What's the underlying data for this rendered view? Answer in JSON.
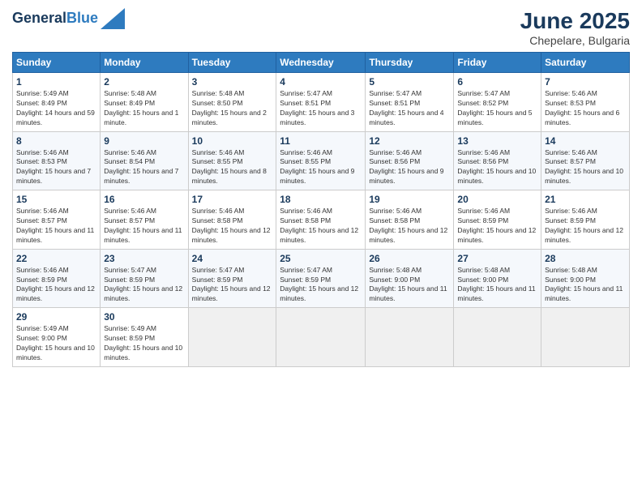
{
  "header": {
    "logo_line1": "General",
    "logo_line2": "Blue",
    "month": "June 2025",
    "location": "Chepelare, Bulgaria"
  },
  "days_of_week": [
    "Sunday",
    "Monday",
    "Tuesday",
    "Wednesday",
    "Thursday",
    "Friday",
    "Saturday"
  ],
  "weeks": [
    [
      {
        "num": "1",
        "sunrise": "Sunrise: 5:49 AM",
        "sunset": "Sunset: 8:49 PM",
        "daylight": "Daylight: 14 hours and 59 minutes."
      },
      {
        "num": "2",
        "sunrise": "Sunrise: 5:48 AM",
        "sunset": "Sunset: 8:49 PM",
        "daylight": "Daylight: 15 hours and 1 minute."
      },
      {
        "num": "3",
        "sunrise": "Sunrise: 5:48 AM",
        "sunset": "Sunset: 8:50 PM",
        "daylight": "Daylight: 15 hours and 2 minutes."
      },
      {
        "num": "4",
        "sunrise": "Sunrise: 5:47 AM",
        "sunset": "Sunset: 8:51 PM",
        "daylight": "Daylight: 15 hours and 3 minutes."
      },
      {
        "num": "5",
        "sunrise": "Sunrise: 5:47 AM",
        "sunset": "Sunset: 8:51 PM",
        "daylight": "Daylight: 15 hours and 4 minutes."
      },
      {
        "num": "6",
        "sunrise": "Sunrise: 5:47 AM",
        "sunset": "Sunset: 8:52 PM",
        "daylight": "Daylight: 15 hours and 5 minutes."
      },
      {
        "num": "7",
        "sunrise": "Sunrise: 5:46 AM",
        "sunset": "Sunset: 8:53 PM",
        "daylight": "Daylight: 15 hours and 6 minutes."
      }
    ],
    [
      {
        "num": "8",
        "sunrise": "Sunrise: 5:46 AM",
        "sunset": "Sunset: 8:53 PM",
        "daylight": "Daylight: 15 hours and 7 minutes."
      },
      {
        "num": "9",
        "sunrise": "Sunrise: 5:46 AM",
        "sunset": "Sunset: 8:54 PM",
        "daylight": "Daylight: 15 hours and 7 minutes."
      },
      {
        "num": "10",
        "sunrise": "Sunrise: 5:46 AM",
        "sunset": "Sunset: 8:55 PM",
        "daylight": "Daylight: 15 hours and 8 minutes."
      },
      {
        "num": "11",
        "sunrise": "Sunrise: 5:46 AM",
        "sunset": "Sunset: 8:55 PM",
        "daylight": "Daylight: 15 hours and 9 minutes."
      },
      {
        "num": "12",
        "sunrise": "Sunrise: 5:46 AM",
        "sunset": "Sunset: 8:56 PM",
        "daylight": "Daylight: 15 hours and 9 minutes."
      },
      {
        "num": "13",
        "sunrise": "Sunrise: 5:46 AM",
        "sunset": "Sunset: 8:56 PM",
        "daylight": "Daylight: 15 hours and 10 minutes."
      },
      {
        "num": "14",
        "sunrise": "Sunrise: 5:46 AM",
        "sunset": "Sunset: 8:57 PM",
        "daylight": "Daylight: 15 hours and 10 minutes."
      }
    ],
    [
      {
        "num": "15",
        "sunrise": "Sunrise: 5:46 AM",
        "sunset": "Sunset: 8:57 PM",
        "daylight": "Daylight: 15 hours and 11 minutes."
      },
      {
        "num": "16",
        "sunrise": "Sunrise: 5:46 AM",
        "sunset": "Sunset: 8:57 PM",
        "daylight": "Daylight: 15 hours and 11 minutes."
      },
      {
        "num": "17",
        "sunrise": "Sunrise: 5:46 AM",
        "sunset": "Sunset: 8:58 PM",
        "daylight": "Daylight: 15 hours and 12 minutes."
      },
      {
        "num": "18",
        "sunrise": "Sunrise: 5:46 AM",
        "sunset": "Sunset: 8:58 PM",
        "daylight": "Daylight: 15 hours and 12 minutes."
      },
      {
        "num": "19",
        "sunrise": "Sunrise: 5:46 AM",
        "sunset": "Sunset: 8:58 PM",
        "daylight": "Daylight: 15 hours and 12 minutes."
      },
      {
        "num": "20",
        "sunrise": "Sunrise: 5:46 AM",
        "sunset": "Sunset: 8:59 PM",
        "daylight": "Daylight: 15 hours and 12 minutes."
      },
      {
        "num": "21",
        "sunrise": "Sunrise: 5:46 AM",
        "sunset": "Sunset: 8:59 PM",
        "daylight": "Daylight: 15 hours and 12 minutes."
      }
    ],
    [
      {
        "num": "22",
        "sunrise": "Sunrise: 5:46 AM",
        "sunset": "Sunset: 8:59 PM",
        "daylight": "Daylight: 15 hours and 12 minutes."
      },
      {
        "num": "23",
        "sunrise": "Sunrise: 5:47 AM",
        "sunset": "Sunset: 8:59 PM",
        "daylight": "Daylight: 15 hours and 12 minutes."
      },
      {
        "num": "24",
        "sunrise": "Sunrise: 5:47 AM",
        "sunset": "Sunset: 8:59 PM",
        "daylight": "Daylight: 15 hours and 12 minutes."
      },
      {
        "num": "25",
        "sunrise": "Sunrise: 5:47 AM",
        "sunset": "Sunset: 8:59 PM",
        "daylight": "Daylight: 15 hours and 12 minutes."
      },
      {
        "num": "26",
        "sunrise": "Sunrise: 5:48 AM",
        "sunset": "Sunset: 9:00 PM",
        "daylight": "Daylight: 15 hours and 11 minutes."
      },
      {
        "num": "27",
        "sunrise": "Sunrise: 5:48 AM",
        "sunset": "Sunset: 9:00 PM",
        "daylight": "Daylight: 15 hours and 11 minutes."
      },
      {
        "num": "28",
        "sunrise": "Sunrise: 5:48 AM",
        "sunset": "Sunset: 9:00 PM",
        "daylight": "Daylight: 15 hours and 11 minutes."
      }
    ],
    [
      {
        "num": "29",
        "sunrise": "Sunrise: 5:49 AM",
        "sunset": "Sunset: 9:00 PM",
        "daylight": "Daylight: 15 hours and 10 minutes."
      },
      {
        "num": "30",
        "sunrise": "Sunrise: 5:49 AM",
        "sunset": "Sunset: 8:59 PM",
        "daylight": "Daylight: 15 hours and 10 minutes."
      },
      null,
      null,
      null,
      null,
      null
    ]
  ]
}
